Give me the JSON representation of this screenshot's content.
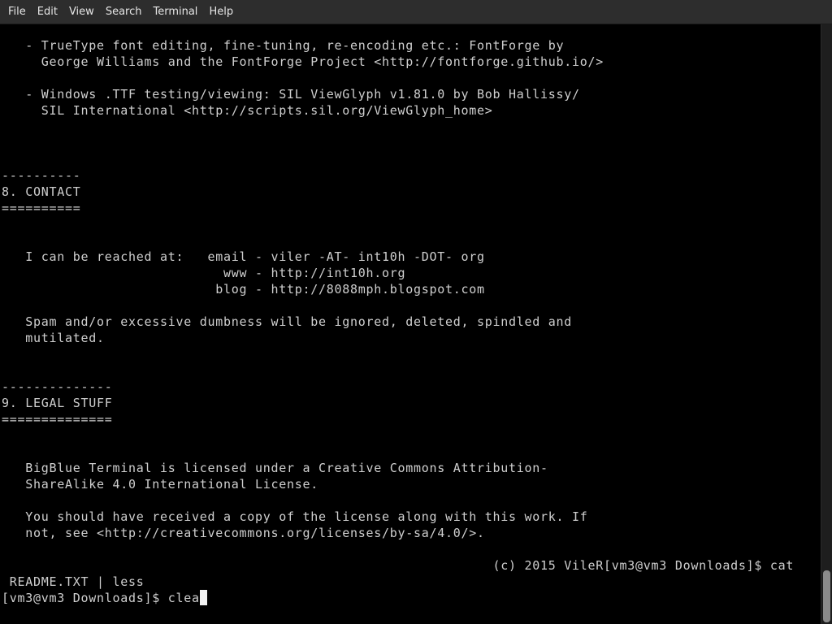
{
  "menubar": {
    "items": [
      "File",
      "Edit",
      "View",
      "Search",
      "Terminal",
      "Help"
    ]
  },
  "terminal": {
    "lines": [
      "   - TrueType font editing, fine-tuning, re-encoding etc.: FontForge by",
      "     George Williams and the FontForge Project <http://fontforge.github.io/>",
      "",
      "   - Windows .TTF testing/viewing: SIL ViewGlyph v1.81.0 by Bob Hallissy/",
      "     SIL International <http://scripts.sil.org/ViewGlyph_home>",
      "",
      "",
      "",
      "----------",
      "8. CONTACT",
      "==========",
      "",
      "",
      "   I can be reached at:   email - viler -AT- int10h -DOT- org",
      "                            www - http://int10h.org",
      "                           blog - http://8088mph.blogspot.com",
      "",
      "   Spam and/or excessive dumbness will be ignored, deleted, spindled and",
      "   mutilated.",
      "",
      "",
      "--------------",
      "9. LEGAL STUFF",
      "==============",
      "",
      "",
      "   BigBlue Terminal is licensed under a Creative Commons Attribution-",
      "   ShareAlike 4.0 International License.",
      "",
      "   You should have received a copy of the license along with this work. If",
      "   not, see <http://creativecommons.org/licenses/by-sa/4.0/>.",
      "",
      "                                                              (c) 2015 VileR[vm3@vm3 Downloads]$ cat",
      " README.TXT | less"
    ],
    "prompt": "[vm3@vm3 Downloads]$ ",
    "input": "clea"
  }
}
